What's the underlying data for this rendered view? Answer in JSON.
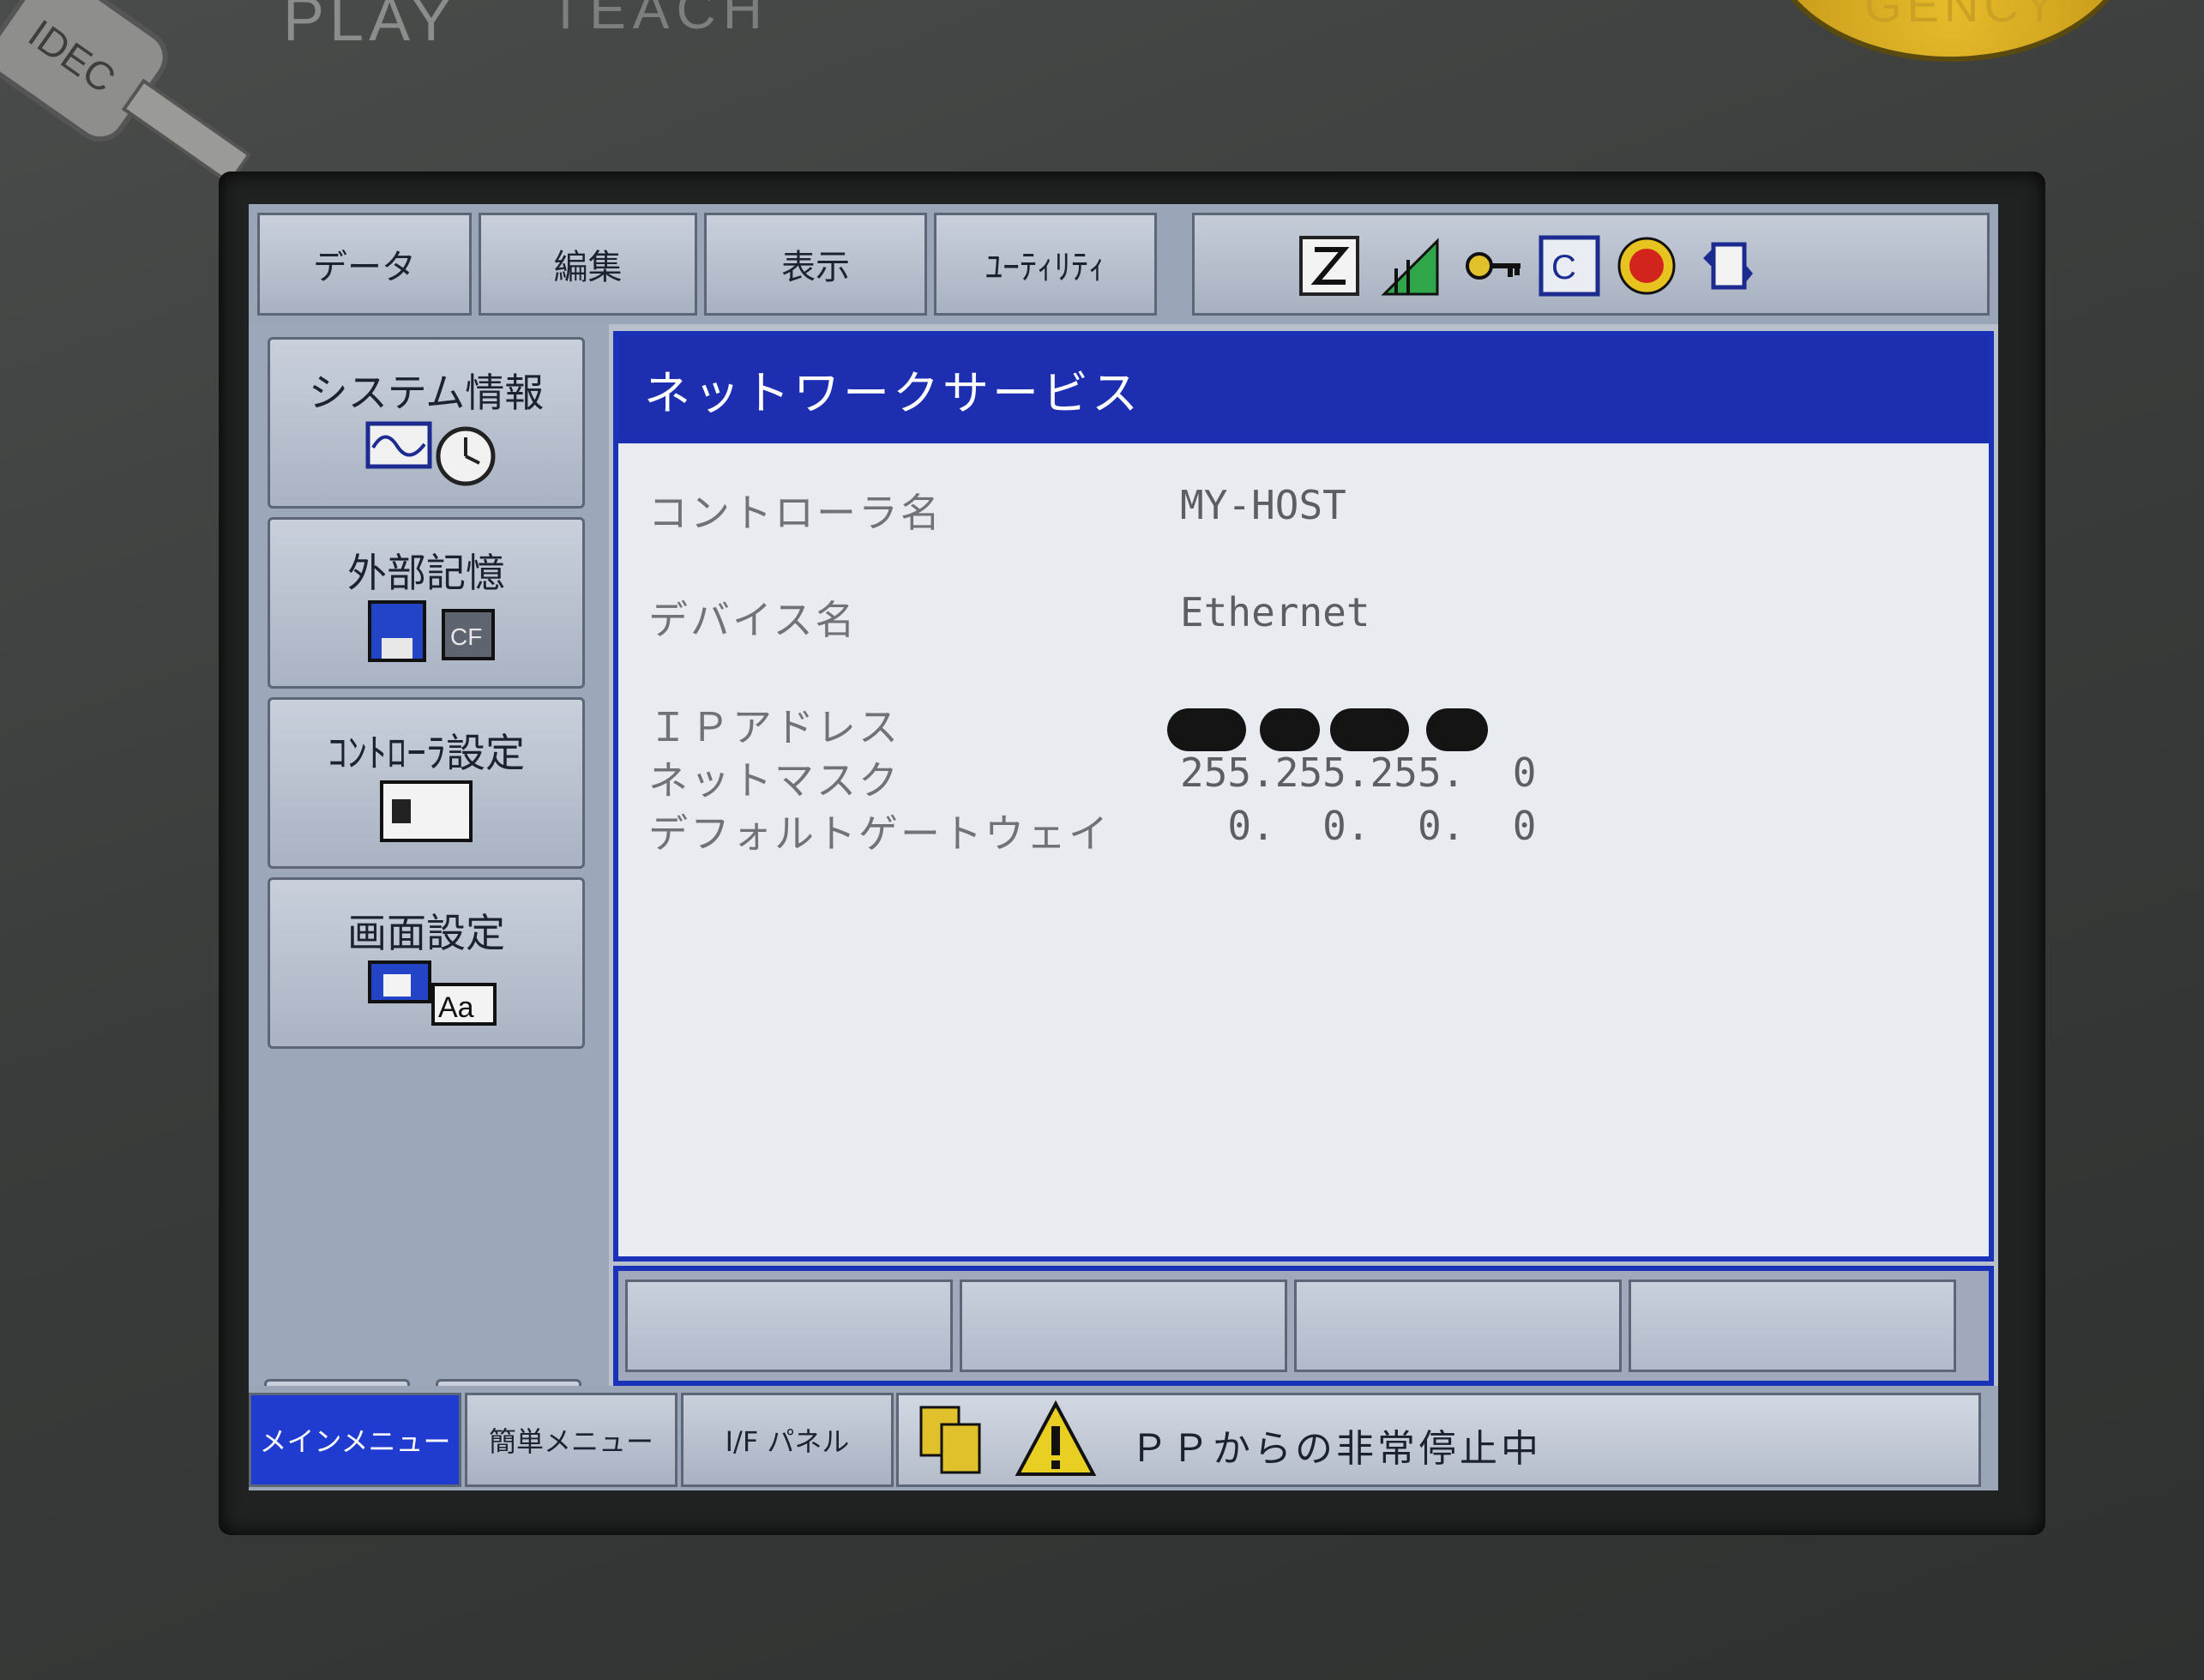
{
  "device": {
    "top_labels": [
      "PLAY",
      "TEACH"
    ],
    "estop_label": "GENCY",
    "key_brand": "IDEC"
  },
  "menubar": {
    "tabs": [
      "データ",
      "編集",
      "表示",
      "ﾕｰﾃｨﾘﾃｨ"
    ]
  },
  "sidebar": {
    "items": [
      "システム情報",
      "外部記憶",
      "ｺﾝﾄﾛｰﾗ設定",
      "画面設定"
    ]
  },
  "window": {
    "title": "ネットワークサービス",
    "fields": [
      {
        "label": "コントローラ名",
        "value": "MY-HOST"
      },
      {
        "label": "デバイス名",
        "value": "Ethernet"
      },
      {
        "label": "ＩＰアドレス",
        "value": ""
      },
      {
        "label": "ネットマスク",
        "value": "255.255.255.  0"
      },
      {
        "label": "デフォルトゲートウェイ",
        "value": "  0.  0.  0.  0"
      }
    ]
  },
  "bottombar": {
    "tabs": [
      "メインメニュー",
      "簡単メニュー",
      "I/F パネル"
    ],
    "active_tab": "メインメニュー",
    "message": "ＰＰからの非常停止中"
  },
  "colors": {
    "title_bar": "#1d2fb0",
    "active_tab": "#1f3bd0",
    "panel": "#e8ebef",
    "estop": "#e6bb2a"
  }
}
